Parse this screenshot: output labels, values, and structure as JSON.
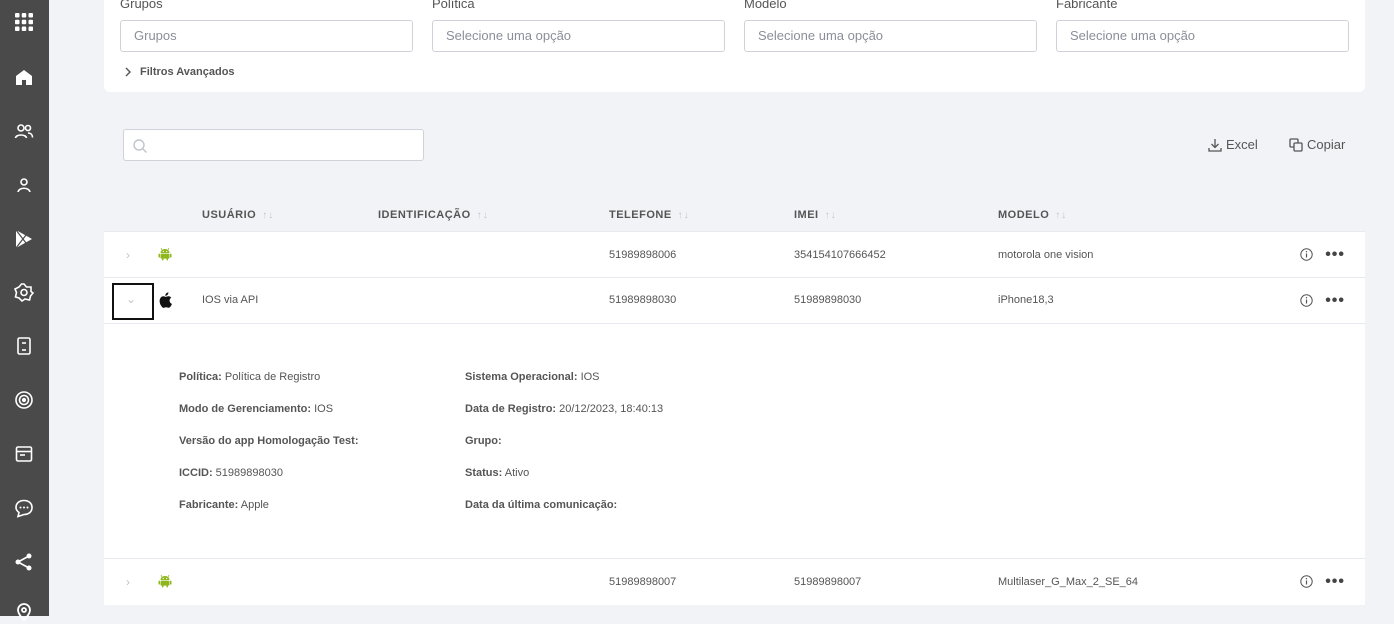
{
  "filters": {
    "groups": {
      "label": "Grupos",
      "placeholder": "Grupos"
    },
    "policy": {
      "label": "Política",
      "placeholder": "Selecione uma opção"
    },
    "model": {
      "label": "Modelo",
      "placeholder": "Selecione uma opção"
    },
    "manufacturer": {
      "label": "Fabricante",
      "placeholder": "Selecione uma opção"
    },
    "advanced_label": "Filtros Avançados"
  },
  "toolbar": {
    "excel_label": "Excel",
    "copy_label": "Copiar"
  },
  "columns": [
    "USUÁRIO",
    "IDENTIFICAÇÃO",
    "TELEFONE",
    "IMEI",
    "MODELO"
  ],
  "sort_glyph": "↑↓",
  "rows": [
    {
      "os_icon": "android-icon",
      "user": "",
      "identification": "",
      "phone": "51989898006",
      "imei": "354154107666452",
      "model": "motorola one vision"
    },
    {
      "os_icon": "apple-icon",
      "user": "IOS via API",
      "identification": "",
      "phone": "51989898030",
      "imei": "51989898030",
      "model": "iPhone18,3"
    },
    {
      "os_icon": "android-icon",
      "user": "",
      "identification": "",
      "phone": "51989898007",
      "imei": "51989898007",
      "model": "Multilaser_G_Max_2_SE_64"
    }
  ],
  "details": {
    "policy": {
      "label": "Política:",
      "value": "Política de Registro"
    },
    "mgmt_mode": {
      "label": "Modo de Gerenciamento:",
      "value": "IOS"
    },
    "app_version": {
      "label": "Versão do app Homologação Test:",
      "value": ""
    },
    "iccid": {
      "label": "ICCID:",
      "value": "51989898030"
    },
    "manufacturer": {
      "label": "Fabricante:",
      "value": "Apple"
    },
    "os": {
      "label": "Sistema Operacional:",
      "value": "IOS"
    },
    "reg_date": {
      "label": "Data de Registro:",
      "value": "20/12/2023, 18:40:13"
    },
    "group": {
      "label": "Grupo:",
      "value": ""
    },
    "status": {
      "label": "Status:",
      "value": "Ativo"
    },
    "last_comm": {
      "label": "Data da última comunicação:",
      "value": ""
    }
  },
  "sidebar_icons": [
    "apps-grid-icon",
    "home-icon",
    "users-icon",
    "user-icon",
    "play-store-icon",
    "settings-flower-icon",
    "device-icon",
    "target-icon",
    "calendar-icon",
    "chat-icon",
    "share-icon",
    "location-icon"
  ]
}
